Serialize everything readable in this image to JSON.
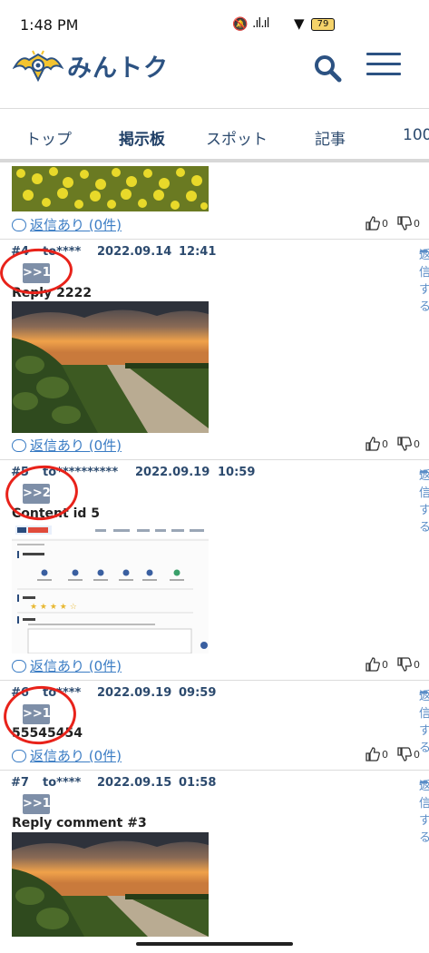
{
  "status_bar": {
    "time": "1:48 PM",
    "battery": "79"
  },
  "header": {
    "logo_text": "みんトク"
  },
  "tabs": [
    {
      "label": "トップ"
    },
    {
      "label": "掲示板"
    },
    {
      "label": "スポット"
    },
    {
      "label": "記事"
    },
    {
      "label": "100"
    }
  ],
  "posts": [
    {
      "comments_label": "返信あり (0件)",
      "likes": "0",
      "dislikes": "0"
    },
    {
      "number": "#4",
      "user": "to****",
      "date": "2022.09.14",
      "time": "12:41",
      "reply_label": "返信する",
      "quote": ">>1",
      "text": "Reply 2222",
      "comments_label": "返信あり (0件)",
      "likes": "0",
      "dislikes": "0"
    },
    {
      "number": "#5",
      "user": "to**********",
      "date": "2022.09.19",
      "time": "10:59",
      "reply_label": "返信する",
      "quote": ">>2",
      "text": "Content id 5",
      "comments_label": "返信あり (0件)",
      "likes": "0",
      "dislikes": "0"
    },
    {
      "number": "#6",
      "user": "to****",
      "date": "2022.09.19",
      "time": "09:59",
      "reply_label": "返信する",
      "quote": ">>1",
      "text": "55545454",
      "comments_label": "返信あり (0件)",
      "likes": "0",
      "dislikes": "0"
    },
    {
      "number": "#7",
      "user": "to****",
      "date": "2022.09.15",
      "time": "01:58",
      "reply_label": "返信する",
      "quote": ">>1",
      "text": "Reply comment #3"
    }
  ],
  "colors": {
    "brand": "#2c5282",
    "link": "#3a7cc4",
    "annotation": "#e8221a",
    "quote_chip": "#7e8fa8"
  }
}
